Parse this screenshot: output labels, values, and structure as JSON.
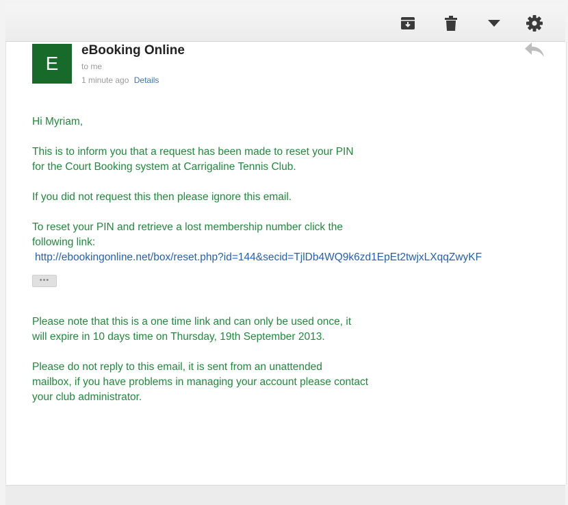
{
  "toolbar": {
    "archive_icon": "archive-icon",
    "delete_icon": "trash-icon",
    "more_icon": "chevron-down-icon",
    "settings_icon": "gear-icon"
  },
  "message": {
    "avatar_letter": "E",
    "avatar_color": "#176a2a",
    "sender": "eBooking Online",
    "recipient": "to me",
    "time": "1 minute ago",
    "details_link": "Details",
    "reply_icon": "reply-icon",
    "body": {
      "greeting": "Hi Myriam,",
      "para1_line1": "This is to inform you that a request has been made to reset your PIN",
      "para1_line2": "for the Court Booking system at Carrigaline Tennis Club.",
      "para2": "If you did not request this then please ignore this email.",
      "para3_line1": "To reset your PIN and retrieve a lost membership number click the",
      "para3_line2": "following link:",
      "link": "http://ebookingonline.net/box/reset.php?id=144&secid=TjlDb4WQ9k6zd1EpEt2twjxLXqqZwyKF",
      "more_label": "•••",
      "para4_line1": "Please note that this is a one time link and can only be used once, it",
      "para4_line2": "will expire in 10 days time on Thursday, 19th September 2013.",
      "para5_line1": "Please do not reply to this email, it is sent from an unattended",
      "para5_line2": "mailbox, if you have problems in managing your account please contact",
      "para5_line3": "your club administrator."
    },
    "text_color": "#1f8a3b",
    "link_color": "#2460b8"
  }
}
